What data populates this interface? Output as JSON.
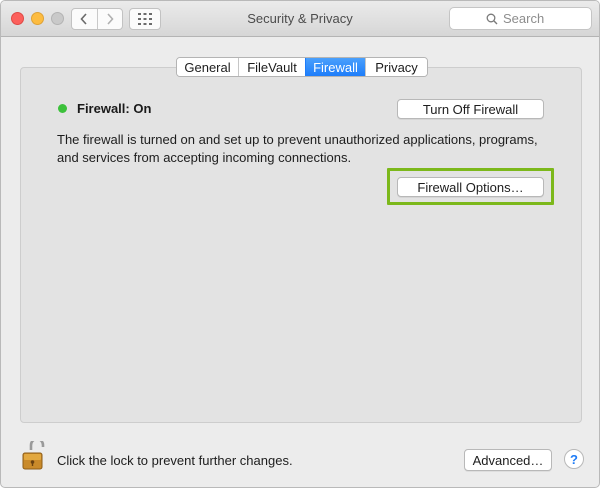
{
  "window": {
    "title": "Security & Privacy"
  },
  "toolbar": {
    "search_placeholder": "Search",
    "back_icon": "chevron-left-icon",
    "forward_icon": "chevron-right-icon",
    "grid_icon": "show-all-grid-icon"
  },
  "tabs": [
    {
      "label": "General",
      "active": false
    },
    {
      "label": "FileVault",
      "active": false
    },
    {
      "label": "Firewall",
      "active": true
    },
    {
      "label": "Privacy",
      "active": false
    }
  ],
  "firewall": {
    "status_label": "Firewall: On",
    "status_color": "#3cc13b",
    "turn_off_label": "Turn Off Firewall",
    "description": "The firewall is turned on and set up to prevent unauthorized applications, programs, and services from accepting incoming connections.",
    "options_label": "Firewall Options…",
    "highlight_color": "#7cb81b"
  },
  "footer": {
    "lock_text": "Click the lock to prevent further changes.",
    "advanced_label": "Advanced…",
    "help_label": "?"
  },
  "colors": {
    "accent": "#1e7dfa",
    "close": "#fc605c",
    "minimize": "#fdbc40",
    "zoom_disabled": "#c9c9c9"
  }
}
